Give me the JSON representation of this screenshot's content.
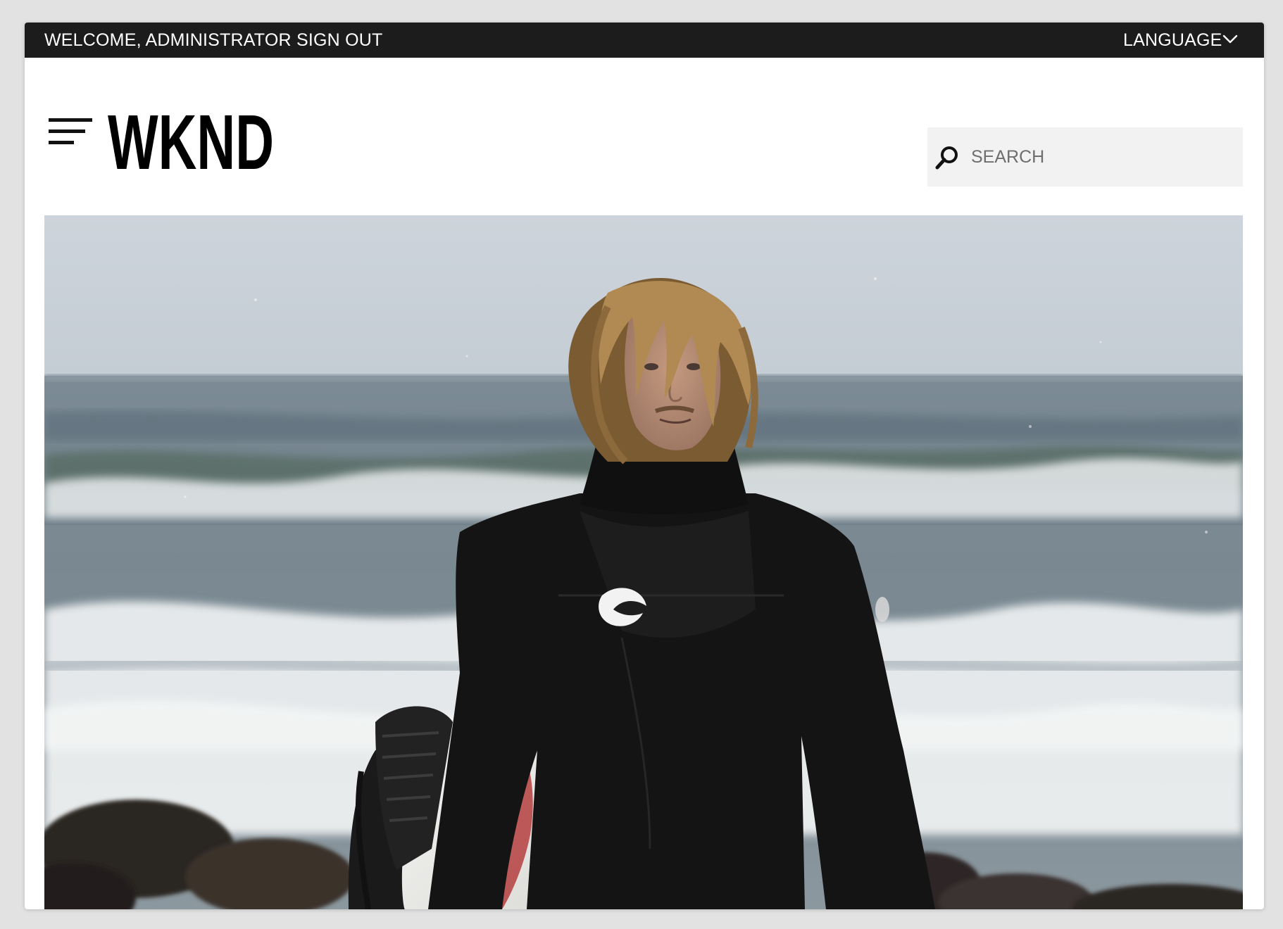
{
  "topbar": {
    "welcome": "WELCOME, ADMINISTRATOR",
    "sign_out": "SIGN OUT",
    "language": "LANGUAGE"
  },
  "header": {
    "logo_text": "WKND",
    "search_placeholder": "SEARCH"
  },
  "icons": {
    "menu": "hamburger-menu-icon",
    "search": "search-icon",
    "language_toggle": "chevron-down-icon"
  },
  "hero": {
    "subject": "surfer in black wetsuit holding surfboard on rocky beach"
  },
  "colors": {
    "topbar_bg": "#1c1c1c",
    "search_bg": "#f2f2f2",
    "page_bg": "#e2e2e2"
  }
}
